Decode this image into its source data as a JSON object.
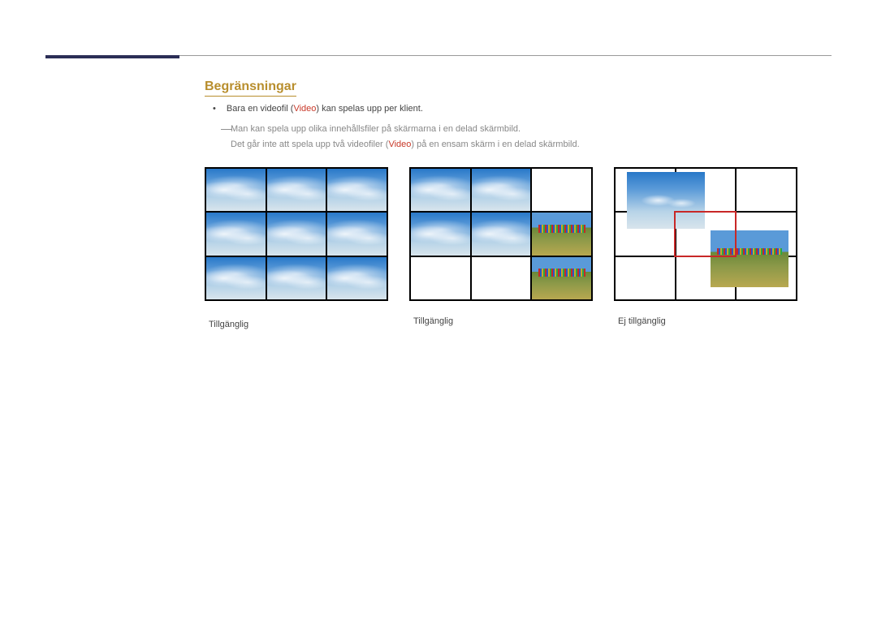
{
  "section_title": "Begränsningar",
  "bullets": {
    "line1_pre": "Bara en videofil (",
    "line1_hl": "Video",
    "line1_post": ") kan spelas upp per klient.",
    "dash1": "Man kan spela upp olika innehållsfiler på skärmarna i en delad skärmbild.",
    "dash2_pre": "Det går inte att spela upp två videofiler (",
    "dash2_hl": "Video",
    "dash2_post": ") på en ensam skärm i en delad skärmbild."
  },
  "captions": {
    "fig1": "Tillgänglig",
    "fig2": "Tillgänglig",
    "fig3": "Ej tillgänglig"
  }
}
